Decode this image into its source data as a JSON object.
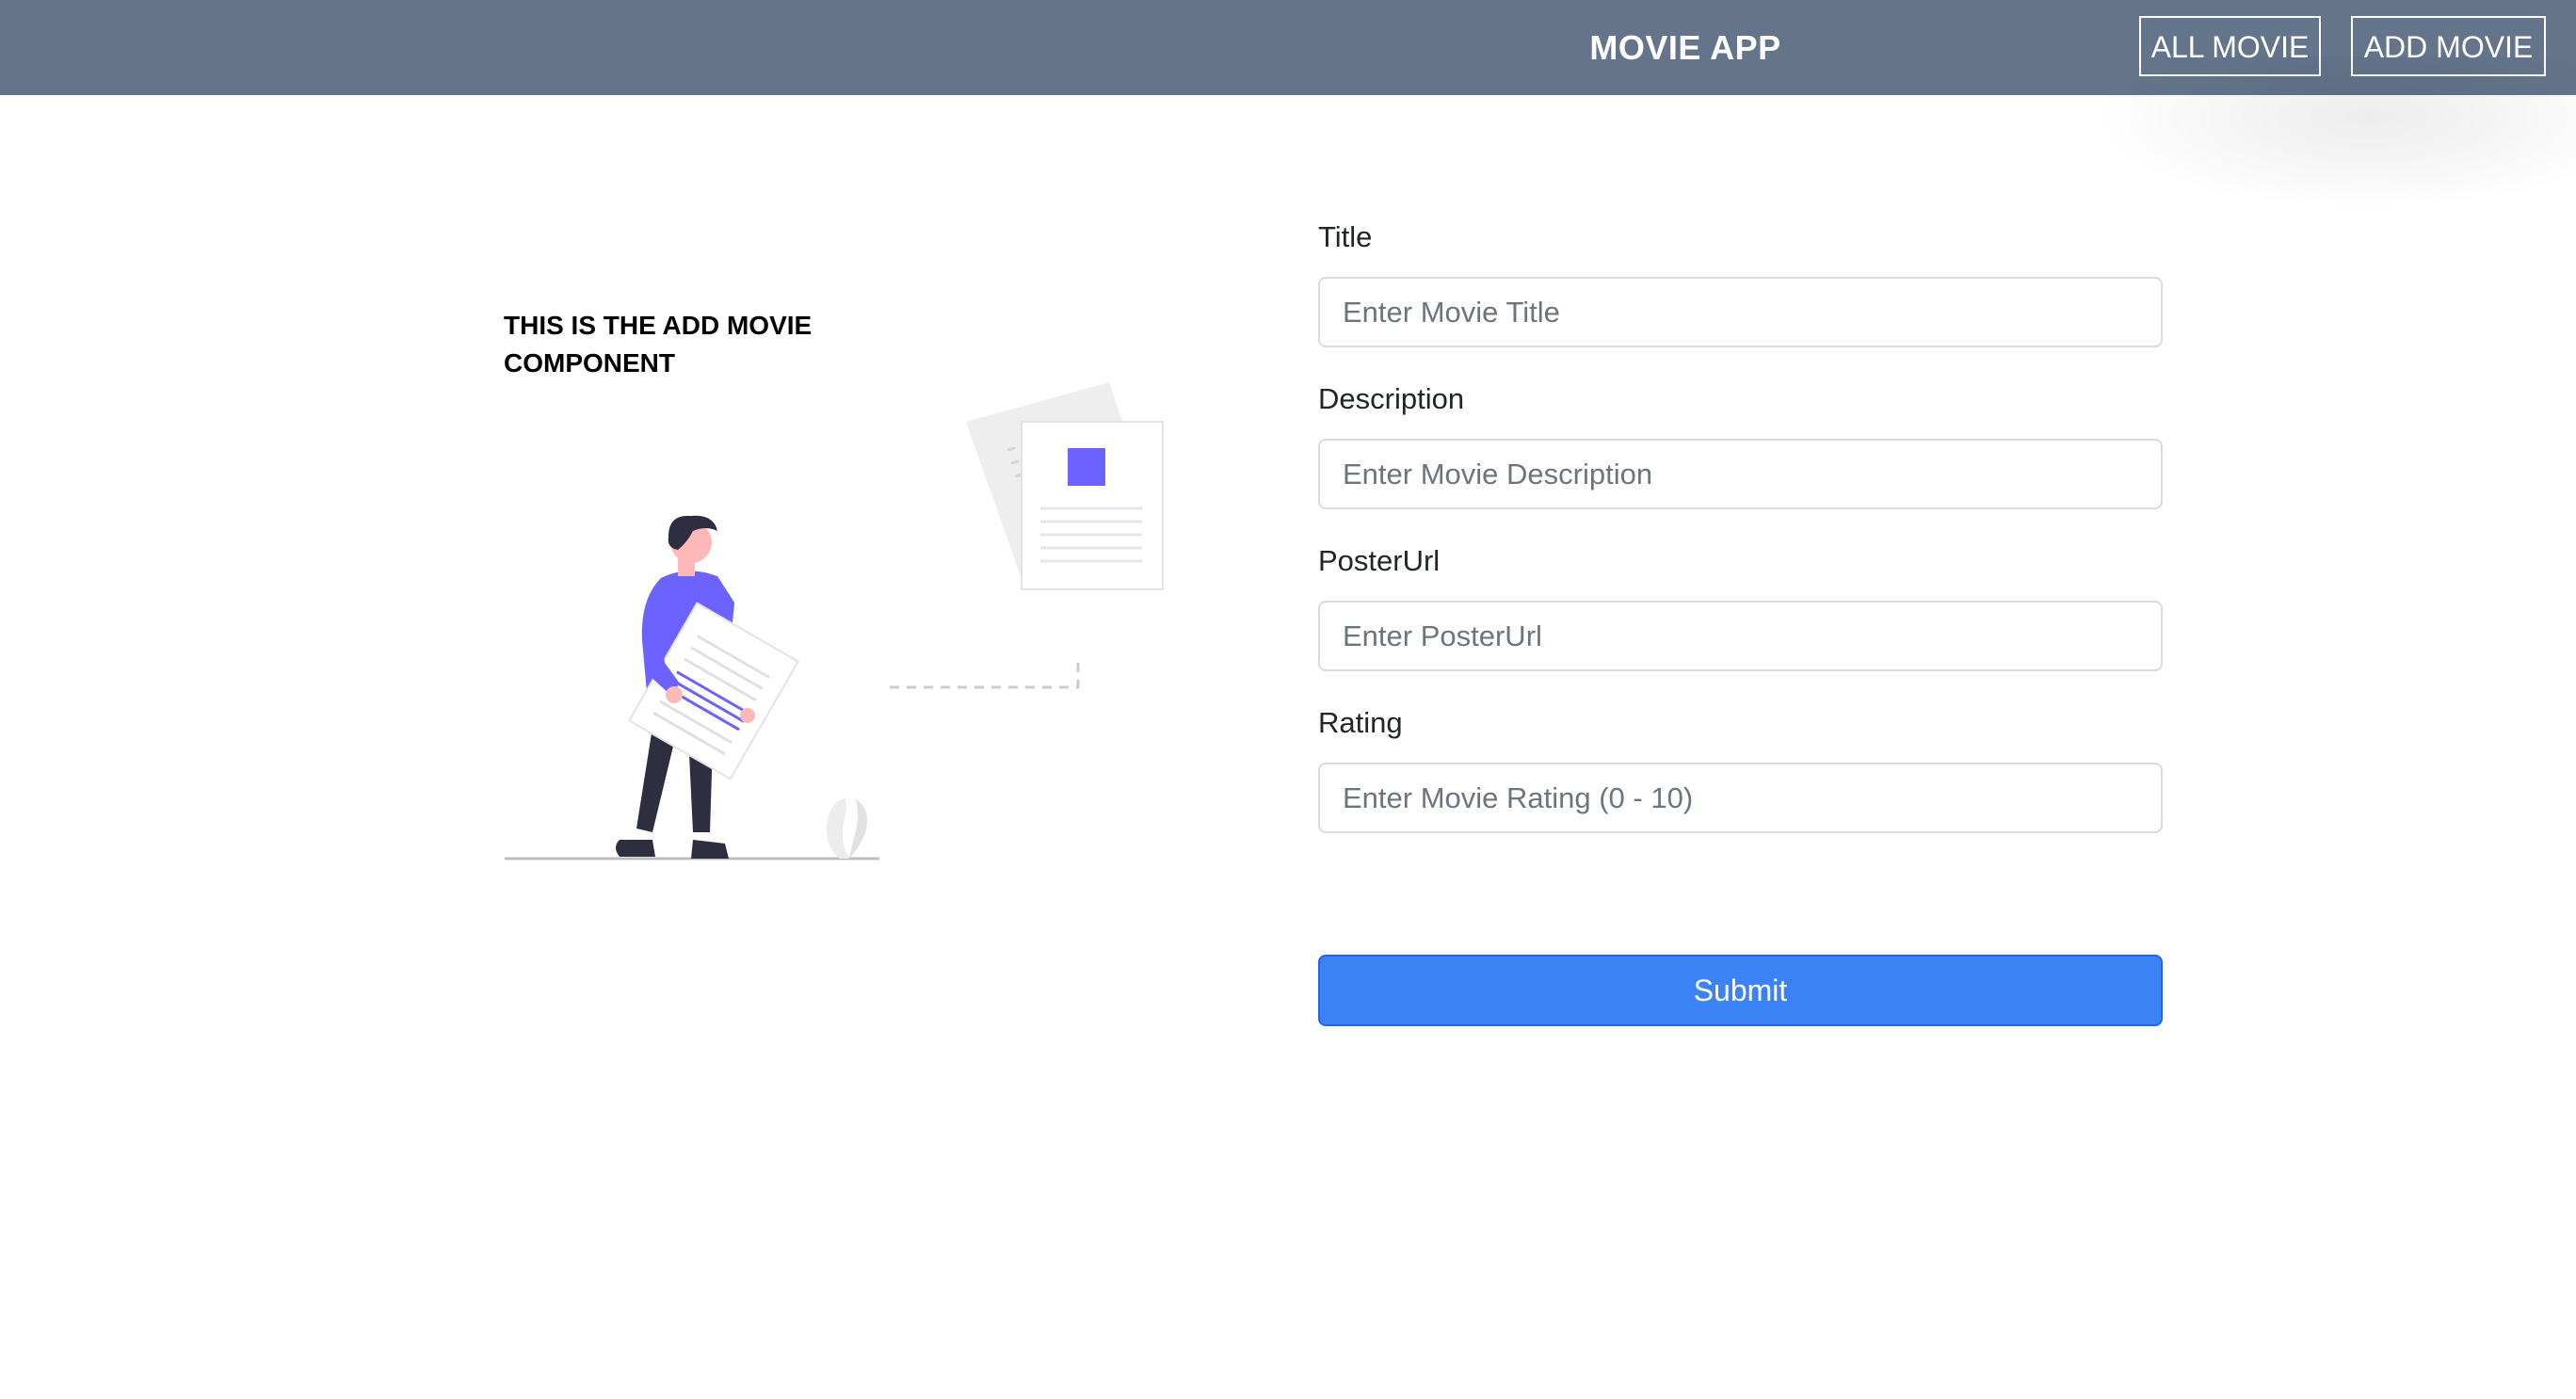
{
  "header": {
    "app_title": "MOVIE APP",
    "nav": {
      "all_movie": "ALL MOVIE",
      "add_movie": "ADD MOVIE"
    },
    "background_color": "#64748b"
  },
  "left_panel": {
    "heading": "THIS IS THE ADD MOVIE COMPONENT",
    "illustration_icon": "person-carrying-document-illustration",
    "accent_color": "#6c63ff"
  },
  "form": {
    "fields": [
      {
        "label": "Title",
        "placeholder": "Enter Movie Title",
        "value": ""
      },
      {
        "label": "Description",
        "placeholder": "Enter Movie Description",
        "value": ""
      },
      {
        "label": "PosterUrl",
        "placeholder": "Enter PosterUrl",
        "value": ""
      },
      {
        "label": "Rating",
        "placeholder": "Enter Movie Rating (0 - 10)",
        "value": ""
      }
    ],
    "submit_label": "Submit",
    "submit_color": "#3b82f6"
  }
}
